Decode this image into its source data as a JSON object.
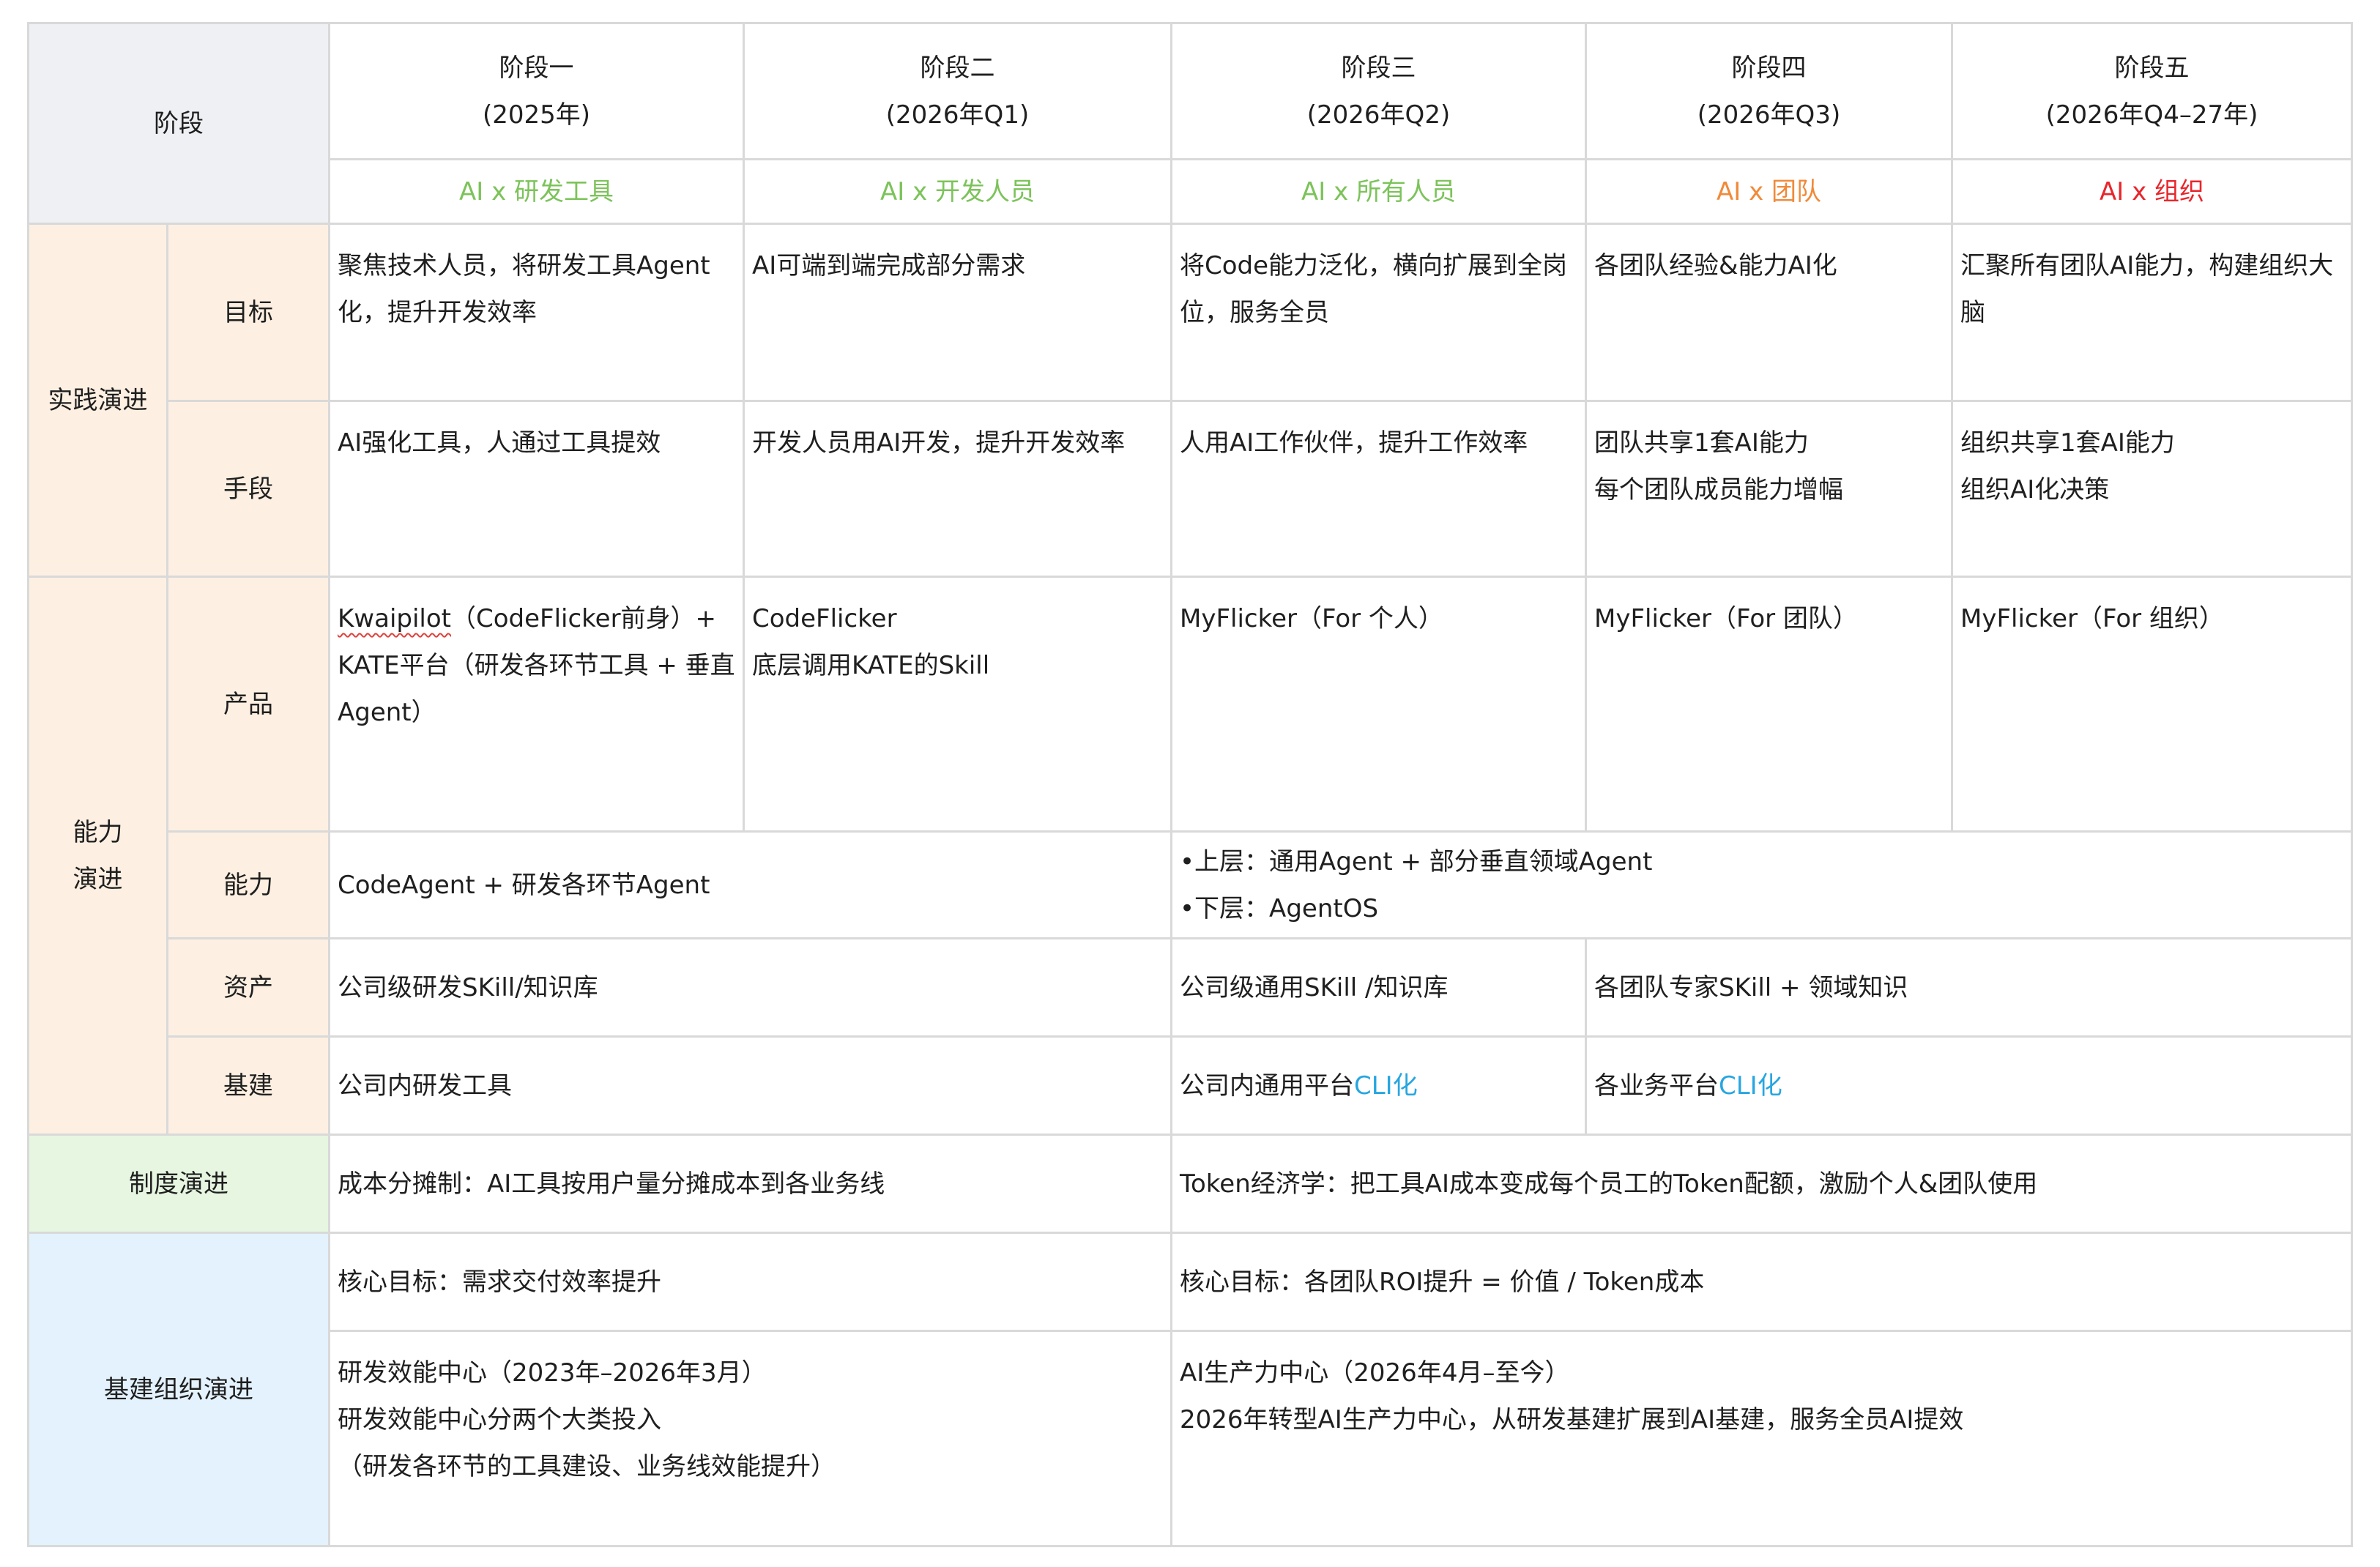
{
  "header": {
    "stage_label": "阶段",
    "stages": [
      {
        "name": "阶段一",
        "period": "(2025年)",
        "theme": "AI x 研发工具",
        "theme_color": "#7cc35a"
      },
      {
        "name": "阶段二",
        "period": "(2026年Q1)",
        "theme": "AI x 开发人员",
        "theme_color": "#7cc35a"
      },
      {
        "name": "阶段三",
        "period": "(2026年Q2)",
        "theme": "AI x 所有人员",
        "theme_color": "#7cc35a"
      },
      {
        "name": "阶段四",
        "period": "(2026年Q3)",
        "theme": "AI x 团队",
        "theme_color": "#f08a3a"
      },
      {
        "name": "阶段五",
        "period": "(2026年Q4–27年)",
        "theme": "AI x 组织",
        "theme_color": "#e8262b"
      }
    ]
  },
  "practice": {
    "group_label": "实践演进",
    "goal": {
      "label": "目标",
      "cells": [
        "聚焦技术人员，将研发工具Agent化，提升开发效率",
        "AI可端到端完成部分需求",
        "将Code能力泛化，横向扩展到全岗位，服务全员",
        "各团队经验&能力AI化",
        "汇聚所有团队AI能力，构建组织大脑"
      ]
    },
    "means": {
      "label": "手段",
      "cells": [
        [
          "AI强化工具，人通过工具提效"
        ],
        [
          "开发人员用AI开发，提升开发效率"
        ],
        [
          "人用AI工作伙伴，提升工作效率"
        ],
        [
          "团队共享1套AI能力",
          "每个团队成员能力增幅"
        ],
        [
          "组织共享1套AI能力",
          "组织AI化决策"
        ]
      ]
    }
  },
  "capability": {
    "group_label_line1": "能力",
    "group_label_line2": "演进",
    "product": {
      "label": "产品",
      "stage1_part1": "Kwaipilot",
      "stage1_part2": "（CodeFlicker前身）+ KATE平台（研发各环节工具 + 垂直Agent）",
      "stage2": [
        "CodeFlicker",
        "底层调用KATE的Skill"
      ],
      "stage3": "MyFlicker（For 个人）",
      "stage4": "MyFlicker（For 团队）",
      "stage5": "MyFlicker（For 组织）"
    },
    "ability": {
      "label": "能力",
      "left": "CodeAgent + 研发各环节Agent",
      "right": [
        "•上层：通用Agent + 部分垂直领域Agent",
        "•下层：AgentOS"
      ]
    },
    "assets": {
      "label": "资产",
      "left": "公司级研发SKill/知识库",
      "mid": "公司级通用SKill /知识库",
      "right": "各团队专家SKill + 领域知识"
    },
    "infra": {
      "label": "基建",
      "left": "公司内研发工具",
      "mid_prefix": "公司内通用平台",
      "mid_suffix": "CLI化",
      "right_prefix": "各业务平台",
      "right_suffix": "CLI化"
    }
  },
  "system": {
    "label": "制度演进",
    "left": "成本分摊制：AI工具按用户量分摊成本到各业务线",
    "right": "Token经济学：把工具AI成本变成每个员工的Token配额，激励个人&团队使用"
  },
  "org": {
    "label": "基建组织演进",
    "goal_left": "核心目标：需求交付效率提升",
    "goal_right": "核心目标：各团队ROI提升 = 价值 / Token成本",
    "detail_left": [
      "研发效能中心（2023年–2026年3月）",
      "研发效能中心分两个大类投入",
      "（研发各环节的工具建设、业务线效能提升）"
    ],
    "detail_right": [
      "AI生产力中心（2026年4月–至今）",
      "2026年转型AI生产力中心，从研发基建扩展到AI基建，服务全员AI提效"
    ]
  },
  "colors": {
    "header_gray": "#eef0f3",
    "practice_orange": "#fdf0e2",
    "system_green": "#e6f6e1",
    "org_blue": "#e3f2fc",
    "link_blue": "#27a6e0"
  }
}
